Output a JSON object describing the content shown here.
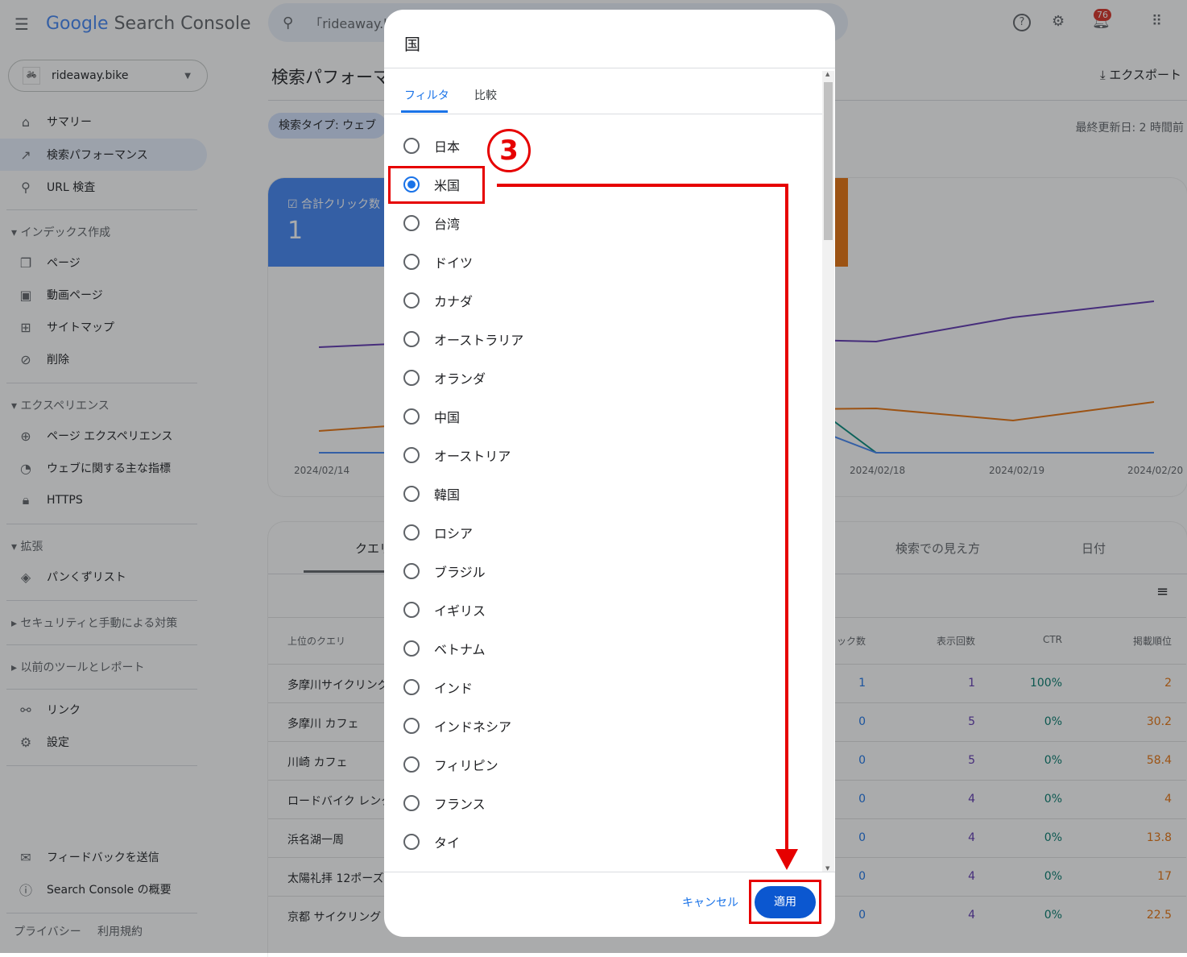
{
  "app": {
    "title_google": "Google",
    "title_product": "Search Console",
    "search_value": "「rideaway.b",
    "notification_count": "76"
  },
  "property": "rideaway.bike",
  "sidebar": {
    "items": [
      {
        "label": "サマリー"
      },
      {
        "label": "検索パフォーマンス"
      },
      {
        "label": "URL 検査"
      }
    ],
    "index_section": "インデックス作成",
    "index_items": [
      {
        "label": "ページ"
      },
      {
        "label": "動画ページ"
      },
      {
        "label": "サイトマップ"
      },
      {
        "label": "削除"
      }
    ],
    "experience_section": "エクスペリエンス",
    "experience_items": [
      {
        "label": "ページ エクスペリエンス"
      },
      {
        "label": "ウェブに関する主な指標"
      },
      {
        "label": "HTTPS"
      }
    ],
    "enhance_section": "拡張",
    "enhance_items": [
      {
        "label": "パンくずリスト"
      }
    ],
    "security_section": "セキュリティと手動による対策",
    "legacy_section": "以前のツールとレポート",
    "bottom_items": [
      {
        "label": "リンク"
      },
      {
        "label": "設定"
      }
    ],
    "feedback": "フィードバックを送信",
    "about": "Search Console の概要",
    "privacy": "プライバシー",
    "terms": "利用規約"
  },
  "main": {
    "page_title": "検索パフォーマンス",
    "export": "エクスポート",
    "filter_chip": "検索タイプ: ウェブ",
    "last_updated": "最終更新日: 2 時間前",
    "metric_label": "合計クリック数",
    "metric_value": "1",
    "chart_dates": [
      "2024/02/14",
      "2024/02/18",
      "2024/02/19",
      "2024/02/20"
    ],
    "tabs": [
      "クエリ",
      "検索での見え方",
      "日付"
    ],
    "columns": [
      "上位のクエリ",
      "クリック数",
      "表示回数",
      "CTR",
      "掲載順位"
    ],
    "rows": [
      {
        "q": "多摩川サイクリング",
        "c": "1",
        "i": "1",
        "ctr": "100%",
        "p": "2"
      },
      {
        "q": "多摩川 カフェ",
        "c": "0",
        "i": "5",
        "ctr": "0%",
        "p": "30.2"
      },
      {
        "q": "川崎 カフェ",
        "c": "0",
        "i": "5",
        "ctr": "0%",
        "p": "58.4"
      },
      {
        "q": "ロードバイク レンタル",
        "c": "0",
        "i": "4",
        "ctr": "0%",
        "p": "4"
      },
      {
        "q": "浜名湖一周",
        "c": "0",
        "i": "4",
        "ctr": "0%",
        "p": "13.8"
      },
      {
        "q": "太陽礼拝 12ポーズ",
        "c": "0",
        "i": "4",
        "ctr": "0%",
        "p": "17"
      },
      {
        "q": "京都 サイクリング",
        "c": "0",
        "i": "4",
        "ctr": "0%",
        "p": "22.5"
      }
    ]
  },
  "dialog": {
    "title": "国",
    "tabs": [
      "フィルタ",
      "比較"
    ],
    "selected": "米国",
    "options": [
      "日本",
      "米国",
      "台湾",
      "ドイツ",
      "カナダ",
      "オーストラリア",
      "オランダ",
      "中国",
      "オーストリア",
      "韓国",
      "ロシア",
      "ブラジル",
      "イギリス",
      "ベトナム",
      "インド",
      "インドネシア",
      "フィリピン",
      "フランス",
      "タイ"
    ],
    "cancel": "キャンセル",
    "apply": "適用"
  },
  "annotation": {
    "step": "③",
    "color": "#e60000"
  }
}
